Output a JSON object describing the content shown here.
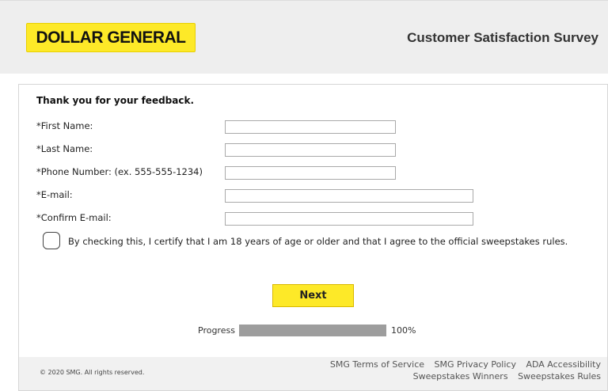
{
  "header": {
    "logo_text": "DOLLAR GENERAL",
    "survey_title": "Customer Satisfaction Survey"
  },
  "form": {
    "intro": "Thank you for your feedback.",
    "fields": [
      {
        "label": "*First Name:",
        "value": ""
      },
      {
        "label": "*Last Name:",
        "value": ""
      },
      {
        "label": "*Phone Number: (ex. 555-555-1234)",
        "value": ""
      },
      {
        "label": "*E-mail:",
        "value": ""
      },
      {
        "label": "*Confirm E-mail:",
        "value": ""
      }
    ],
    "certify_text": "By checking this, I certify that I am 18 years of age or older and that I agree to the official sweepstakes rules.",
    "certify_checked": false,
    "next_label": "Next"
  },
  "progress": {
    "label": "Progress",
    "percent_text": "100%",
    "fraction": 1.0
  },
  "footer": {
    "copyright": "© 2020 SMG. All rights reserved.",
    "links_row1": [
      "SMG Terms of Service",
      "SMG Privacy Policy",
      "ADA Accessibility"
    ],
    "links_row2": [
      "Sweepstakes Winners",
      "Sweepstakes Rules"
    ]
  },
  "colors": {
    "brand_yellow": "#fde928",
    "progress_fill": "#9d9d9d"
  }
}
